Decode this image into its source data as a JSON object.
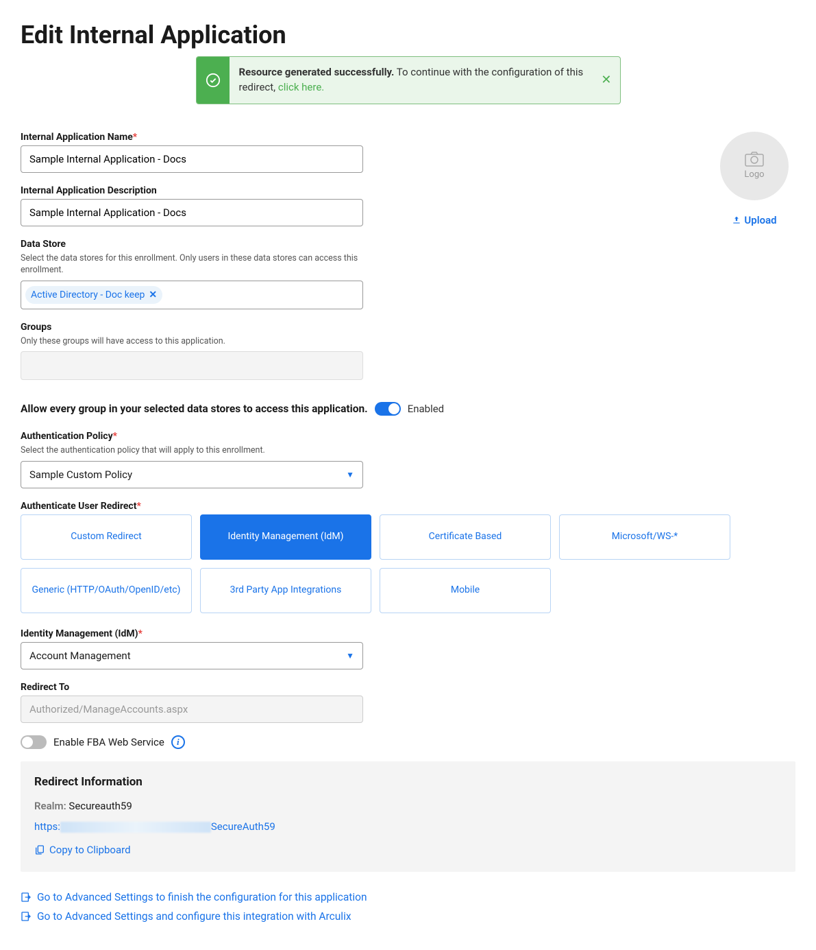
{
  "page": {
    "title": "Edit Internal Application"
  },
  "alert": {
    "strong": "Resource generated successfully.",
    "text": " To continue with the configuration of this redirect, ",
    "link": "click here."
  },
  "logo": {
    "placeholder": "Logo",
    "upload": "Upload"
  },
  "fields": {
    "name": {
      "label": "Internal Application Name",
      "value": "Sample Internal Application - Docs"
    },
    "description": {
      "label": "Internal Application Description",
      "value": "Sample Internal Application - Docs"
    },
    "datastore": {
      "label": "Data Store",
      "help": "Select the data stores for this enrollment. Only users in these data stores can access this enrollment.",
      "chip": "Active Directory - Doc keep"
    },
    "groups": {
      "label": "Groups",
      "help": "Only these groups will have access to this application."
    },
    "allow_all": {
      "label": "Allow every group in your selected data stores to access this application.",
      "state": "Enabled"
    },
    "auth_policy": {
      "label": "Authentication Policy",
      "help": "Select the authentication policy that will apply to this enrollment.",
      "value": "Sample Custom Policy"
    },
    "auth_redirect": {
      "label": "Authenticate User Redirect"
    },
    "idm": {
      "label": "Identity Management (IdM)",
      "value": "Account Management"
    },
    "redirect_to": {
      "label": "Redirect To",
      "value": "Authorized/ManageAccounts.aspx"
    },
    "fba": {
      "label": "Enable FBA Web Service"
    }
  },
  "redirect_cards": [
    "Custom Redirect",
    "Identity Management (IdM)",
    "Certificate Based",
    "Microsoft/WS-*",
    "Generic (HTTP/OAuth/OpenID/etc)",
    "3rd Party App Integrations",
    "Mobile"
  ],
  "info_panel": {
    "title": "Redirect Information",
    "realm_label": "Realm:",
    "realm_value": "Secureauth59",
    "url_prefix": "https:",
    "url_suffix": "SecureAuth59",
    "copy": "Copy to Clipboard"
  },
  "nav_links": [
    "Go to Advanced Settings to finish the configuration for this application",
    "Go to Advanced Settings and configure this integration with Arculix"
  ]
}
